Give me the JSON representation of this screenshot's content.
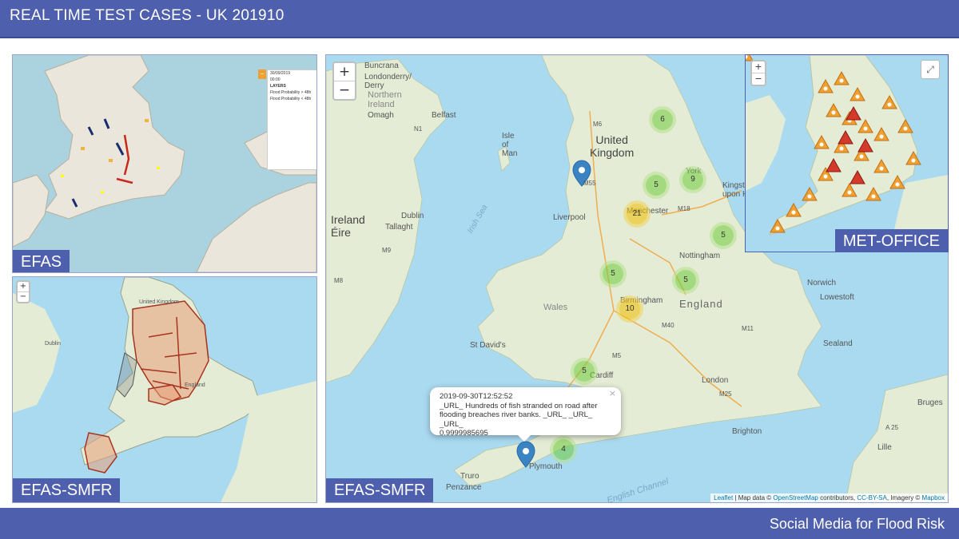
{
  "header": {
    "title": "REAL TIME TEST CASES - UK  201910"
  },
  "footer": {
    "tagline": "Social Media for Flood Risk"
  },
  "panels": {
    "efas": {
      "label": "EFAS",
      "box": {
        "date": "30/09/2019",
        "time": "00:00",
        "layers": "LAYERS",
        "layer1": "Flood Probability > 48h",
        "layer2": "Flood Probability < 48h"
      }
    },
    "efas_smfr_small": {
      "label": "EFAS-SMFR",
      "place_labels": [
        "United Kingdom",
        "England",
        "Dublin"
      ]
    },
    "efas_smfr_main": {
      "label": "EFAS-SMFR"
    },
    "met_office": {
      "label": "MET-OFFICE"
    }
  },
  "main_map": {
    "zoom_in": "+",
    "zoom_out": "−",
    "places": {
      "buncrana": "Buncrana",
      "londonderry": "Londonderry/\nDerry",
      "northern_ireland": "Northern\nIreland",
      "omagh": "Omagh",
      "belfast": "Belfast",
      "isle_of_man": "Isle\nof\nMan",
      "united_kingdom": "United\nKingdom",
      "ireland": "Ireland\nÉire",
      "dublin": "Dublin",
      "tallaght": "Tallaght",
      "liverpool": "Liverpool",
      "manchester": "Manchester",
      "york": "York",
      "kingston": "Kingston\nupon Hull",
      "wales": "Wales",
      "nottingham": "Nottingham",
      "birmingham": "Birmingham",
      "england": "England",
      "norwich": "Norwich",
      "lowestoft": "Lowestoft",
      "st_davids": "St David's",
      "cardiff": "Cardiff",
      "london": "London",
      "brighton": "Brighton",
      "plymouth": "Plymouth",
      "truro": "Truro",
      "penzance": "Penzance",
      "irish_sea": "Irish Sea",
      "english_channel": "English Channel",
      "lille": "Lille",
      "bruges": "Bruges",
      "m6": "M6",
      "m55": "M55",
      "m18": "M18",
      "m40": "M40",
      "m11": "M11",
      "m5": "M5",
      "m25": "M25",
      "a25": "A 25",
      "m8": "M8",
      "m9": "M9",
      "n1": "N1",
      "sealand": "Sealand"
    },
    "clusters": [
      {
        "count": "6",
        "level": "green"
      },
      {
        "count": "9",
        "level": "green"
      },
      {
        "count": "5",
        "level": "green"
      },
      {
        "count": "21",
        "level": "yellow"
      },
      {
        "count": "5",
        "level": "green"
      },
      {
        "count": "5",
        "level": "green"
      },
      {
        "count": "5",
        "level": "green"
      },
      {
        "count": "10",
        "level": "yellow"
      },
      {
        "count": "5",
        "level": "green"
      },
      {
        "count": "4",
        "level": "green"
      }
    ],
    "popup": {
      "timestamp": "2019-09-30T12:52:52",
      "text": "_URL_ Hundreds of fish stranded on road after flooding breaches river banks. _URL_ _URL_ _URL_",
      "score": "0.9999985695",
      "close": "×"
    },
    "attribution": {
      "leaflet": "Leaflet",
      "sep1": " | Map data © ",
      "osm": "OpenStreetMap",
      "contrib": " contributors, ",
      "ccbysa": "CC-BY-SA",
      "imagery": ", Imagery © ",
      "mapbox": "Mapbox"
    }
  },
  "colors": {
    "brand": "#4e5fae",
    "sea": "#aadaf0",
    "land": "#eceee6",
    "flood_red": "#b5453a"
  }
}
